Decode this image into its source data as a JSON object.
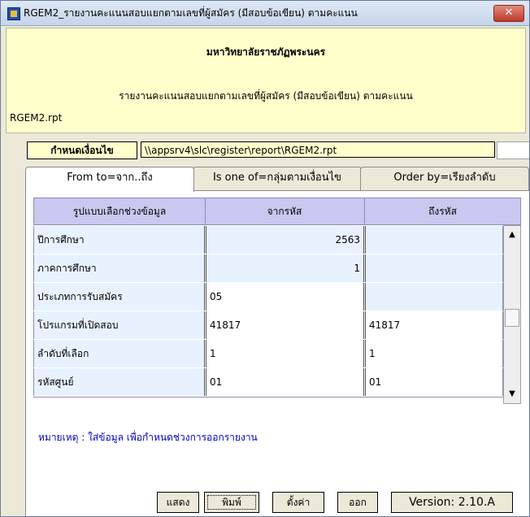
{
  "window": {
    "title": "RGEM2_รายงานคะแนนสอบแยกตามเลขที่ผู้สมัคร (มีสอบข้อเขียน) ตามคะแนน",
    "close_label": "✕"
  },
  "header": {
    "university": "มหาวิทยาลัยราชภัฏพระนคร",
    "report_title": "รายงานคะแนนสอบแยกตามเลขที่ผู้สมัคร (มีสอบข้อเขียน) ตามคะแนน",
    "report_file": "RGEM2.rpt"
  },
  "condition": {
    "label": "กำหนดเงื่อนไข",
    "path": "\\\\appsrv4\\slc\\register\\report\\RGEM2.rpt"
  },
  "tabs": [
    {
      "label": "From to=จาก..ถึง",
      "active": true
    },
    {
      "label": "Is one of=กลุ่มตามเงื่อนไข",
      "active": false
    },
    {
      "label": "Order by=เรียงลำดับ",
      "active": false
    }
  ],
  "grid": {
    "headers": [
      "รูปแบบเลือกช่วงข้อมูล",
      "จากรหัส",
      "ถึงรหัส"
    ],
    "rows": [
      {
        "label": "ปีการศึกษา",
        "from": "2563",
        "to": ""
      },
      {
        "label": "ภาคการศึกษา",
        "from": "1",
        "to": ""
      },
      {
        "label": "ประเภทการรับสมัคร",
        "from": "05",
        "to": ""
      },
      {
        "label": "โปรแกรมที่เปิดสอบ",
        "from": "41817",
        "to": "41817"
      },
      {
        "label": "ลำดับที่เลือก",
        "from": "1",
        "to": "1"
      },
      {
        "label": "รหัสศูนย์",
        "from": "01",
        "to": "01"
      }
    ]
  },
  "note": "หมายเหตุ : ใส่ข้อมูล เพื่อกำหนดช่วงการออกรายงาน",
  "buttons": {
    "show": "แสดง",
    "print": "พิมพ์",
    "settings": "ตั้งค่า",
    "exit": "ออก"
  },
  "version": "Version: 2.10.A",
  "colors": {
    "header_bg": "#ffffcc",
    "grid_header_bg": "#c8c8f0",
    "grid_cell_bg": "#e8f2ff",
    "note_color": "#0000c8"
  }
}
